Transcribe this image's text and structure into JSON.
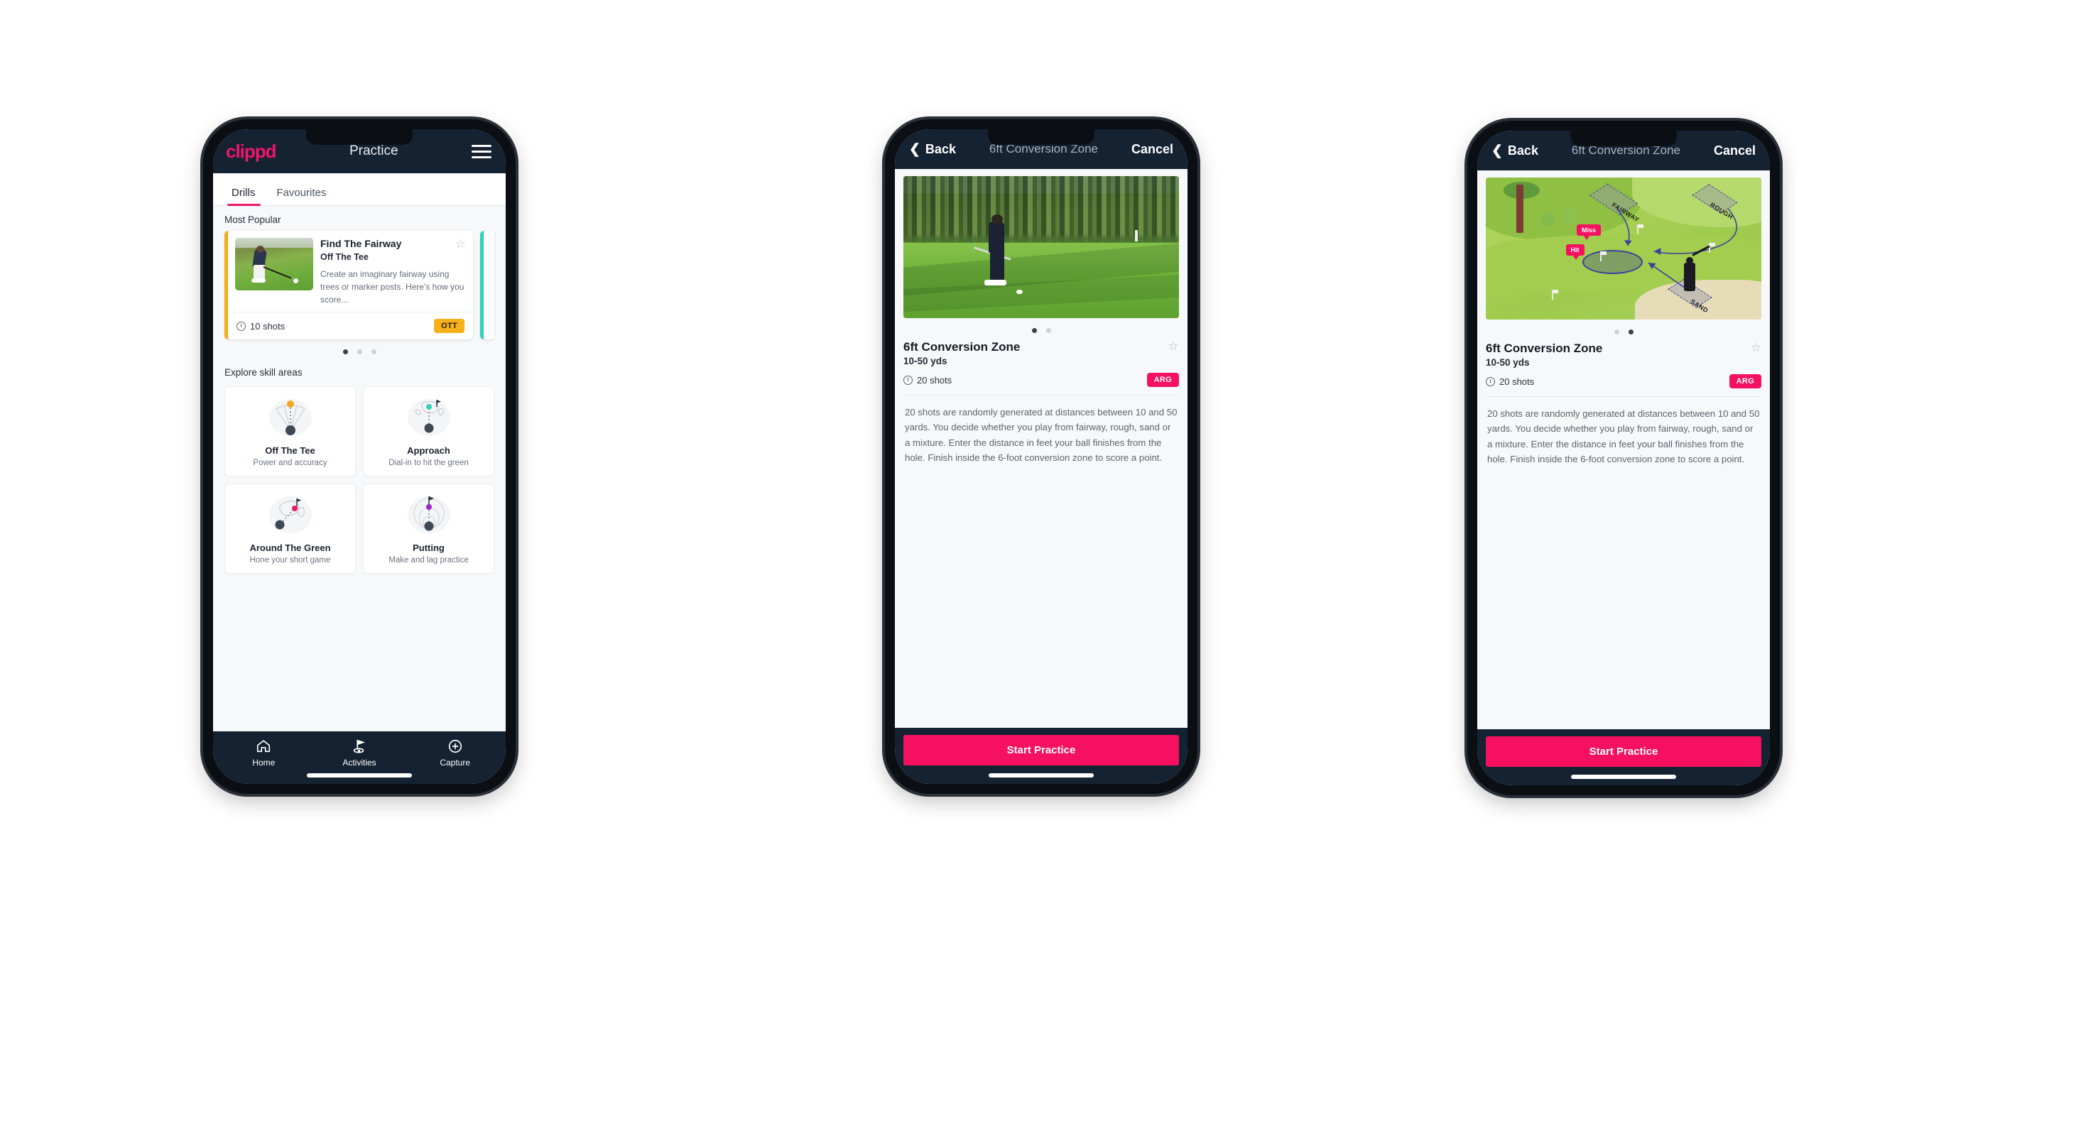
{
  "app": {
    "brand": "clippd",
    "accent_pink": "#f2156c",
    "header_bg": "#152232",
    "badge_ott_color": "#f5b01a",
    "badge_arg_color": "#f5115f",
    "card_accent_amber": "#f5ad17",
    "card_accent_teal": "#2fd4b6"
  },
  "phone1": {
    "appbar": {
      "logo": "clippd",
      "title": "Practice",
      "menu_icon": "hamburger-menu-icon"
    },
    "tabs": [
      {
        "label": "Drills",
        "active": true
      },
      {
        "label": "Favourites",
        "active": false
      }
    ],
    "most_popular": {
      "section_label": "Most Popular",
      "cards": [
        {
          "title": "Find The Fairway",
          "subtitle": "Off The Tee",
          "description": "Create an imaginary fairway using trees or marker posts. Here's how you score...",
          "shots": "10 shots",
          "badge": "OTT",
          "favourite_icon": "star-outline-icon",
          "accent": "#f5ad17"
        }
      ],
      "dots": [
        {
          "active": true
        },
        {
          "active": false
        },
        {
          "active": false
        }
      ]
    },
    "skills": {
      "section_label": "Explore skill areas",
      "items": [
        {
          "name": "Off The Tee",
          "desc": "Power and accuracy",
          "icon": "tee-fan-icon",
          "dot_color": "#f5a623"
        },
        {
          "name": "Approach",
          "desc": "Dial-in to hit the green",
          "icon": "approach-green-icon",
          "dot_color": "#2fd4b6"
        },
        {
          "name": "Around The Green",
          "desc": "Hone your short game",
          "icon": "around-green-icon",
          "dot_color": "#f2156c"
        },
        {
          "name": "Putting",
          "desc": "Make and lag practice",
          "icon": "putting-rings-icon",
          "dot_color": "#a020d0"
        }
      ]
    },
    "bottom_nav": [
      {
        "label": "Home",
        "icon": "home-icon",
        "active": false
      },
      {
        "label": "Activities",
        "icon": "golf-flag-icon",
        "active": true
      },
      {
        "label": "Capture",
        "icon": "plus-circle-icon",
        "active": false
      }
    ]
  },
  "phone2": {
    "navbar": {
      "back": "Back",
      "title": "6ft Conversion Zone",
      "cancel": "Cancel",
      "back_icon": "chevron-left-icon"
    },
    "media_kind": "photo-golfer-pitching",
    "dots": [
      {
        "active": true
      },
      {
        "active": false
      }
    ],
    "detail": {
      "title": "6ft Conversion Zone",
      "subtitle": "10-50 yds",
      "shots": "20 shots",
      "badge": "ARG",
      "favourite_icon": "star-outline-icon",
      "description": "20 shots are randomly generated at distances between 10 and 50 yards. You decide whether you play from fairway, rough, sand or a mixture. Enter the distance in feet your ball finishes from the hole. Finish inside the 6-foot conversion zone to score a point."
    },
    "cta": "Start Practice"
  },
  "phone3": {
    "navbar": {
      "back": "Back",
      "title": "6ft Conversion Zone",
      "cancel": "Cancel",
      "back_icon": "chevron-left-icon"
    },
    "media_kind": "illustration-course-diagram",
    "illustration": {
      "zones": [
        "FAIRWAY",
        "ROUGH",
        "SAND"
      ],
      "labels": [
        "Miss",
        "Hit"
      ]
    },
    "dots": [
      {
        "active": false
      },
      {
        "active": true
      }
    ],
    "detail": {
      "title": "6ft Conversion Zone",
      "subtitle": "10-50 yds",
      "shots": "20 shots",
      "badge": "ARG",
      "favourite_icon": "star-outline-icon",
      "description": "20 shots are randomly generated at distances between 10 and 50 yards. You decide whether you play from fairway, rough, sand or a mixture. Enter the distance in feet your ball finishes from the hole. Finish inside the 6-foot conversion zone to score a point."
    },
    "cta": "Start Practice"
  }
}
